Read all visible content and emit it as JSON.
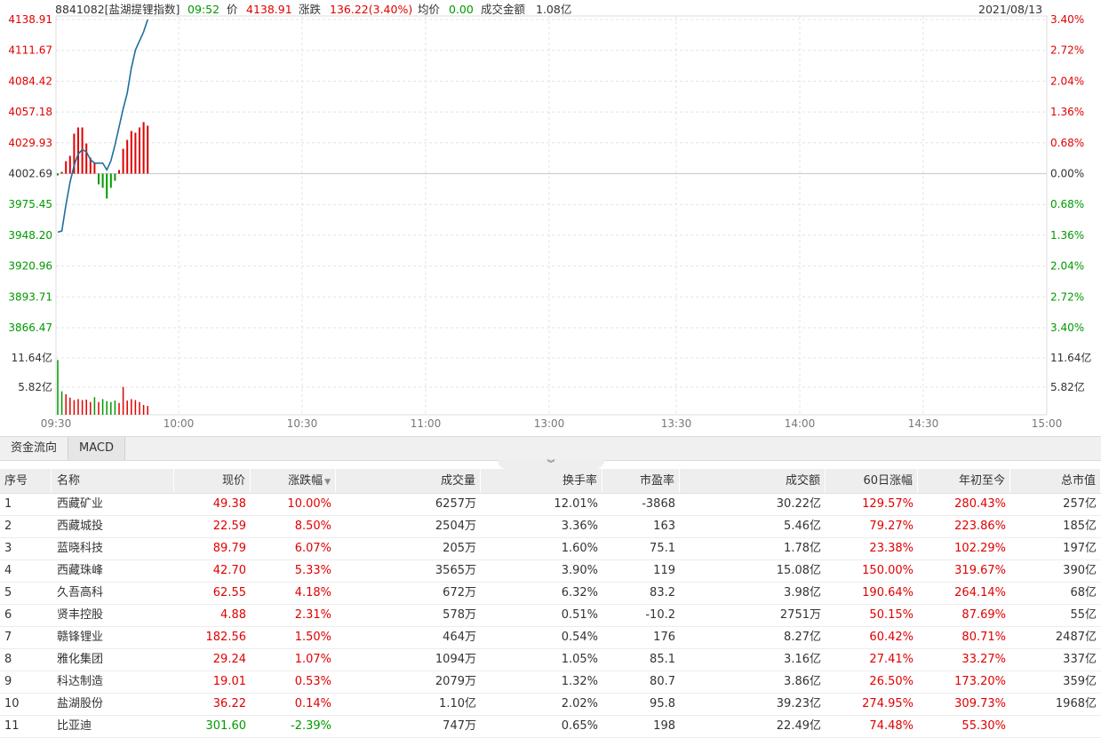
{
  "header": {
    "code_name": "8841082[盐湖提锂指数]",
    "time": "09:52",
    "price_label": "价",
    "price": "4138.91",
    "change_label": "涨跌",
    "change": "136.22(3.40%)",
    "avg_label": "均价",
    "avg": "0.00",
    "amount_label": "成交金额",
    "amount": "1.08亿",
    "date": "2021/08/13"
  },
  "colors": {
    "up": "#e00000",
    "down": "#009900",
    "line": "#1f6e9c",
    "grid": "#e3e3e3"
  },
  "axes": {
    "price_ticks": [
      "4138.91",
      "4111.67",
      "4084.42",
      "4057.18",
      "4029.93",
      "4002.69",
      "3975.45",
      "3948.20",
      "3920.96",
      "3893.71",
      "3866.47"
    ],
    "pct_ticks": [
      "3.40%",
      "2.72%",
      "2.04%",
      "1.36%",
      "0.68%",
      "0.00%",
      "0.68%",
      "1.36%",
      "2.04%",
      "2.72%",
      "3.40%"
    ],
    "volume_ticks": [
      "11.64亿",
      "5.82亿"
    ],
    "time_ticks": [
      "09:30",
      "10:00",
      "10:30",
      "11:00",
      "13:00",
      "13:30",
      "14:00",
      "14:30",
      "15:00"
    ]
  },
  "chart_data": {
    "type": "line",
    "x": [
      "09:30",
      "09:31",
      "09:32",
      "09:33",
      "09:34",
      "09:35",
      "09:36",
      "09:37",
      "09:38",
      "09:39",
      "09:40",
      "09:41",
      "09:42",
      "09:43",
      "09:44",
      "09:45",
      "09:46",
      "09:47",
      "09:48",
      "09:49",
      "09:50",
      "09:51",
      "09:52"
    ],
    "price": [
      3951,
      3952,
      3975,
      3995,
      4010,
      4020,
      4024,
      4022,
      4015,
      4012,
      4012,
      4012,
      4006,
      4014,
      4028,
      4044,
      4060,
      4074,
      4096,
      4112,
      4120,
      4128,
      4138.91
    ],
    "change_bars": [
      -2,
      2,
      14,
      20,
      45,
      52,
      52,
      34,
      18,
      12,
      -12,
      -16,
      -28,
      -16,
      -8,
      4,
      28,
      38,
      48,
      46,
      52,
      58,
      54
    ],
    "volume": [
      11.2,
      4.8,
      4.2,
      3.5,
      3.0,
      3.2,
      3.0,
      3.1,
      2.6,
      3.6,
      2.6,
      3.2,
      2.8,
      2.6,
      2.9,
      2.4,
      5.7,
      2.9,
      3.2,
      3.0,
      2.6,
      2.0,
      1.8
    ],
    "volume_dir": [
      "down",
      "down",
      "up",
      "up",
      "up",
      "up",
      "up",
      "up",
      "up",
      "down",
      "up",
      "down",
      "down",
      "down",
      "down",
      "up",
      "up",
      "up",
      "up",
      "up",
      "up",
      "up",
      "up"
    ],
    "ylim": [
      3866.47,
      4138.91
    ],
    "base": 4002.69
  },
  "tabs": [
    "资金流向",
    "MACD"
  ],
  "table": {
    "headers": [
      "序号",
      "名称",
      "现价",
      "涨跌幅",
      "成交量",
      "换手率",
      "市盈率",
      "成交额",
      "60日涨幅",
      "年初至今",
      "总市值"
    ],
    "sort_indicator": "▼",
    "rows": [
      [
        "1",
        "西藏矿业",
        "49.38",
        "10.00%",
        "6257万",
        "12.01%",
        "-3868",
        "30.22亿",
        "129.57%",
        "280.43%",
        "257亿"
      ],
      [
        "2",
        "西藏城投",
        "22.59",
        "8.50%",
        "2504万",
        "3.36%",
        "163",
        "5.46亿",
        "79.27%",
        "223.86%",
        "185亿"
      ],
      [
        "3",
        "蓝晓科技",
        "89.79",
        "6.07%",
        "205万",
        "1.60%",
        "75.1",
        "1.78亿",
        "23.38%",
        "102.29%",
        "197亿"
      ],
      [
        "4",
        "西藏珠峰",
        "42.70",
        "5.33%",
        "3565万",
        "3.90%",
        "119",
        "15.08亿",
        "150.00%",
        "319.67%",
        "390亿"
      ],
      [
        "5",
        "久吾高科",
        "62.55",
        "4.18%",
        "672万",
        "6.32%",
        "83.2",
        "3.98亿",
        "190.64%",
        "264.14%",
        "68亿"
      ],
      [
        "6",
        "贤丰控股",
        "4.88",
        "2.31%",
        "578万",
        "0.51%",
        "-10.2",
        "2751万",
        "50.15%",
        "87.69%",
        "55亿"
      ],
      [
        "7",
        "赣锋锂业",
        "182.56",
        "1.50%",
        "464万",
        "0.54%",
        "176",
        "8.27亿",
        "60.42%",
        "80.71%",
        "2487亿"
      ],
      [
        "8",
        "雅化集团",
        "29.24",
        "1.07%",
        "1094万",
        "1.05%",
        "85.1",
        "3.16亿",
        "27.41%",
        "33.27%",
        "337亿"
      ],
      [
        "9",
        "科达制造",
        "19.01",
        "0.53%",
        "2079万",
        "1.32%",
        "80.7",
        "3.86亿",
        "26.50%",
        "173.20%",
        "359亿"
      ],
      [
        "10",
        "盐湖股份",
        "36.22",
        "0.14%",
        "1.10亿",
        "2.02%",
        "95.8",
        "39.23亿",
        "274.95%",
        "309.73%",
        "1968亿"
      ],
      [
        "11",
        "比亚迪",
        "301.60",
        "-2.39%",
        "747万",
        "0.65%",
        "198",
        "22.49亿",
        "74.48%",
        "55.30%",
        ""
      ]
    ]
  }
}
